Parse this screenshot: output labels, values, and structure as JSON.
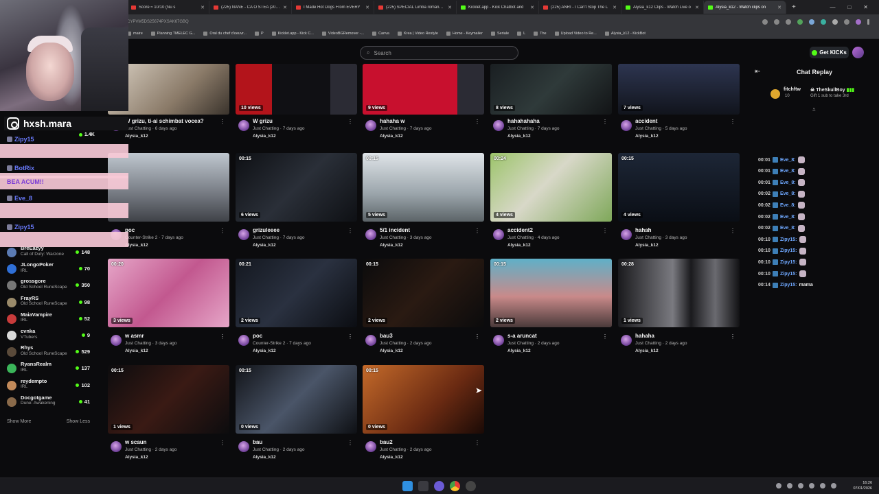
{
  "browser": {
    "tabs": [
      {
        "title": "Score ≈ 10/10 (Nu s",
        "type": "red"
      },
      {
        "title": "(225) NANE - CA O STEA (2005)",
        "type": "red"
      },
      {
        "title": "I Made Hot Dogs From EVERY",
        "type": "red"
      },
      {
        "title": "(225) SPECIAL Limba română, g",
        "type": "red"
      },
      {
        "title": "Kicklet.app - Kick Chatbot and",
        "type": "green"
      },
      {
        "title": "(225) ANRI - I Can't Stop The L",
        "type": "red"
      },
      {
        "title": "Alysia_k12 Clips - Watch Live o",
        "type": "green"
      },
      {
        "title": "Alysia_k12 - Watch clips on",
        "type": "green"
      }
    ],
    "new_tab": "+",
    "url_fragment": "CYPVM5DS25674PXSAK67GBQ",
    "bookmarks": [
      "maire",
      "Planning TMELEC G...",
      "Oral du chef d'oeuvr...",
      "P",
      "Kicklet.app - Kick C...",
      "VideoBGRemover -...",
      "Canva",
      "Krea | Video Restyle",
      "Home - Keymailer",
      "Seriale",
      "L",
      "The",
      "Upload Video to Re...",
      "Alysia_k12 - KickBot"
    ]
  },
  "header": {
    "search_placeholder": "Search",
    "get_kicks": "Get KICKs"
  },
  "overlay": {
    "instagram_handle": "hxsh.mara",
    "chat": [
      {
        "name": "Zipy15",
        "msg": ""
      },
      {
        "name": "BotRix",
        "msg": ""
      },
      {
        "name": "",
        "msg": "BEA    ACUM!!"
      },
      {
        "name": "Eve_8",
        "msg": ""
      },
      {
        "name": "Zipy15",
        "msg": ""
      }
    ],
    "count": "1.4K"
  },
  "sidebar": {
    "channels": [
      {
        "name": "BreEazyy",
        "game": "Call of Duty: Warzone",
        "viewers": "148",
        "color": "#5b7bb3"
      },
      {
        "name": "JLongoPoker",
        "game": "IRL",
        "viewers": "70",
        "color": "#2f6fd6"
      },
      {
        "name": "grossgore",
        "game": "Old School RuneScape",
        "viewers": "350",
        "color": "#777"
      },
      {
        "name": "FrayRS",
        "game": "Old School RuneScape",
        "viewers": "98",
        "color": "#9a8a6a"
      },
      {
        "name": "MaiaVampire",
        "game": "IRL",
        "viewers": "52",
        "color": "#c83b3b"
      },
      {
        "name": "cvnka",
        "game": "VTubers",
        "viewers": "9",
        "color": "#d8d8d8"
      },
      {
        "name": "Rhys",
        "game": "Old School RuneScape",
        "viewers": "529",
        "color": "#5a4a3a"
      },
      {
        "name": "RyansRealm",
        "game": "IRL",
        "viewers": "137",
        "color": "#3bb55a"
      },
      {
        "name": "reydempto",
        "game": "IRL",
        "viewers": "102",
        "color": "#c28a5a"
      },
      {
        "name": "Docgotgame",
        "game": "Dune: Awakening",
        "viewers": "41",
        "color": "#8a6a4a"
      }
    ],
    "show_more": "Show More",
    "show_less": "Show Less"
  },
  "clips": [
    {
      "title": "W grizu, ti-ai schimbat vocea?",
      "sub": "Just Chatting · 6 days ago",
      "channel": "Alysia_k12",
      "duration": "",
      "views": "",
      "theme": "t1"
    },
    {
      "title": "W grizu",
      "sub": "Just Chatting · 7 days ago",
      "channel": "Alysia_k12",
      "duration": "",
      "views": "10 views",
      "theme": "t2"
    },
    {
      "title": "hahaha w",
      "sub": "Just Chatting · 7 days ago",
      "channel": "Alysia_k12",
      "duration": "",
      "views": "9 views",
      "theme": "t3"
    },
    {
      "title": "hahahahaha",
      "sub": "Just Chatting · 7 days ago",
      "channel": "Alysia_k12",
      "duration": "",
      "views": "8 views",
      "theme": "t4"
    },
    {
      "title": "accident",
      "sub": "Just Chatting · 5 days ago",
      "channel": "Alysia_k12",
      "duration": "",
      "views": "7 views",
      "theme": "t5"
    },
    {
      "title": "poc",
      "sub": "Counter-Strike 2 · 7 days ago",
      "channel": "Alysia_k12",
      "duration": "",
      "views": "",
      "theme": "t6"
    },
    {
      "title": "grizuleeee",
      "sub": "Just Chatting · 7 days ago",
      "channel": "Alysia_k12",
      "duration": "00:15",
      "views": "6 views",
      "theme": "t7"
    },
    {
      "title": "5/1 incident",
      "sub": "Just Chatting · 3 days ago",
      "channel": "Alysia_k12",
      "duration": "00:15",
      "views": "5 views",
      "theme": "t8"
    },
    {
      "title": "accident2",
      "sub": "Just Chatting · 4 days ago",
      "channel": "Alysia_k12",
      "duration": "00:24",
      "views": "4 views",
      "theme": "t9"
    },
    {
      "title": "hahah",
      "sub": "Just Chatting · 3 days ago",
      "channel": "Alysia_k12",
      "duration": "00:15",
      "views": "4 views",
      "theme": "t10"
    },
    {
      "title": "w asmr",
      "sub": "Just Chatting · 3 days ago",
      "channel": "Alysia_k12",
      "duration": "00:20",
      "views": "3 views",
      "theme": "t11"
    },
    {
      "title": "poc",
      "sub": "Counter-Strike 2 · 7 days ago",
      "channel": "Alysia_k12",
      "duration": "00:21",
      "views": "2 views",
      "theme": "t12"
    },
    {
      "title": "bau3",
      "sub": "Just Chatting · 2 days ago",
      "channel": "Alysia_k12",
      "duration": "00:15",
      "views": "2 views",
      "theme": "t13"
    },
    {
      "title": "s-a aruncat",
      "sub": "Just Chatting · 2 days ago",
      "channel": "Alysia_k12",
      "duration": "00:15",
      "views": "2 views",
      "theme": "t14"
    },
    {
      "title": "hahaha",
      "sub": "Just Chatting · 2 days ago",
      "channel": "Alysia_k12",
      "duration": "00:28",
      "views": "1 views",
      "theme": "t15"
    },
    {
      "title": "w scaun",
      "sub": "Just Chatting · 2 days ago",
      "channel": "Alysia_k12",
      "duration": "00:15",
      "views": "1 views",
      "theme": "t16"
    },
    {
      "title": "bau",
      "sub": "Just Chatting · 2 days ago",
      "channel": "Alysia_k12",
      "duration": "00:15",
      "views": "0 views",
      "theme": "t17"
    },
    {
      "title": "bau2",
      "sub": "Just Chatting · 2 days ago",
      "channel": "Alysia_k12",
      "duration": "00:15",
      "views": "0 views",
      "theme": "t18"
    }
  ],
  "replay": {
    "title": "Chat Replay",
    "gift": {
      "user1": "fitchftw",
      "count": "10",
      "user2": "TheSkullBoy",
      "desc": "Gift 1 sub to take 3rd"
    },
    "messages": [
      {
        "time": "00:01",
        "name": "Eve_8:",
        "text": ""
      },
      {
        "time": "00:01",
        "name": "Eve_8:",
        "text": ""
      },
      {
        "time": "00:01",
        "name": "Eve_8:",
        "text": ""
      },
      {
        "time": "00:02",
        "name": "Eve_8:",
        "text": ""
      },
      {
        "time": "00:02",
        "name": "Eve_8:",
        "text": ""
      },
      {
        "time": "00:02",
        "name": "Eve_8:",
        "text": ""
      },
      {
        "time": "00:02",
        "name": "Eve_8:",
        "text": ""
      },
      {
        "time": "00:10",
        "name": "Zipy15:",
        "text": ""
      },
      {
        "time": "00:10",
        "name": "Zipy15:",
        "text": ""
      },
      {
        "time": "00:10",
        "name": "Zipy15:",
        "text": ""
      },
      {
        "time": "00:10",
        "name": "Zipy15:",
        "text": ""
      },
      {
        "time": "00:14",
        "name": "Zipy15:",
        "text": "mama"
      }
    ]
  },
  "taskbar": {
    "time": "16:26",
    "date": "07/01/2026"
  }
}
